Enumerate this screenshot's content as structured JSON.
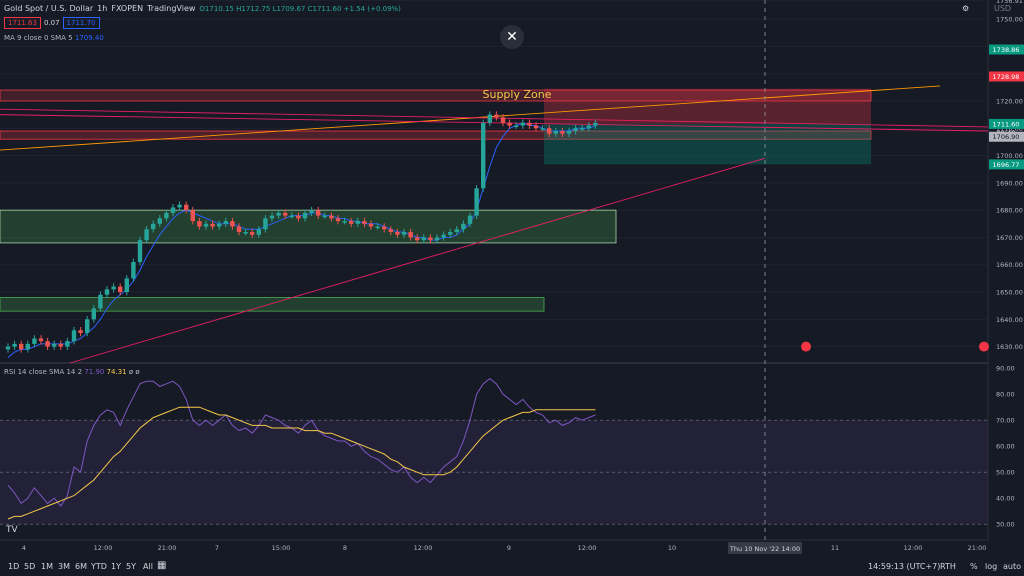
{
  "header": {
    "symbol": "Gold Spot / U.S. Dollar",
    "interval": "1h",
    "exchange": "FXOPEN",
    "provider": "TradingView",
    "ohlc": "O1710.15 H1712.75 L1709.67 C1711.60 +1.54 (+0.09%)",
    "bid": "1711.63",
    "spread": "0.07",
    "ask": "1711.70"
  },
  "indicators": {
    "ma_label": "MA 9 close 0 SMA 5",
    "ma_value": "1709.40",
    "rsi_label": "RSI 14 close SMA 14 2",
    "rsi_value": "71.90",
    "rsi_sma_value": "74.31",
    "rsi_extra": "ø ø"
  },
  "currency": "USD",
  "annotations": {
    "supply_zone": "Supply Zone",
    "logo": "TV"
  },
  "price_tags": {
    "t1738": "1738.86",
    "t1728": "1728.98",
    "t1711": "1711.60",
    "t_timer": "00:48",
    "t1706": "1706.90",
    "t1696": "1696.77"
  },
  "crosshair_label": "Thu 10 Nov '22  14:00",
  "bottom": {
    "ranges": [
      "1D",
      "5D",
      "1M",
      "3M",
      "6M",
      "YTD",
      "1Y",
      "5Y",
      "All"
    ],
    "time": "14:59:13 (UTC+7)",
    "session": "RTH",
    "pct": "%",
    "log": "log",
    "auto": "auto"
  },
  "colors": {
    "up": "#26a69a",
    "down": "#ef5350",
    "ma": "#2962ff",
    "rsi": "#7e57c2",
    "rsi_sma": "#f7c948",
    "bg": "#161a25"
  },
  "chart_data": {
    "type": "candlestick",
    "price_axis_ticks": [
      1756.91,
      1750.0,
      1740.0,
      1730.0,
      1720.0,
      1710.0,
      1700.0,
      1690.0,
      1680.0,
      1670.0,
      1660.0,
      1650.0,
      1640.0,
      1630.0
    ],
    "price_ylim": [
      1624,
      1757
    ],
    "rsi_axis_ticks": [
      90.0,
      80.0,
      70.0,
      60.0,
      50.0,
      40.0,
      30.0
    ],
    "rsi_ylim": [
      27,
      92
    ],
    "time_ticks": [
      "4",
      "12:00",
      "21:00",
      "7",
      "15:00",
      "8",
      "12:00",
      "9",
      "12:00",
      "10",
      "11",
      "12:00",
      "21:00"
    ],
    "closes": [
      1630,
      1631,
      1629,
      1631,
      1633,
      1632,
      1630,
      1631,
      1630,
      1632,
      1636,
      1635,
      1640,
      1644,
      1649,
      1651,
      1652,
      1650,
      1655,
      1661,
      1669,
      1673,
      1675,
      1677,
      1679,
      1681,
      1682,
      1680,
      1676,
      1674,
      1675,
      1674,
      1675,
      1676,
      1674,
      1672,
      1672,
      1671,
      1673,
      1677,
      1678,
      1679,
      1678,
      1678,
      1677,
      1679,
      1680,
      1678,
      1678,
      1677,
      1676,
      1676,
      1675,
      1676,
      1675,
      1674,
      1674,
      1673,
      1672,
      1671,
      1672,
      1670,
      1669,
      1670,
      1669,
      1670,
      1671,
      1672,
      1673,
      1675,
      1678,
      1688,
      1712,
      1715,
      1714,
      1712,
      1711,
      1711,
      1712,
      1711,
      1710,
      1710,
      1708,
      1709,
      1708,
      1709,
      1710,
      1710,
      1711,
      1712
    ],
    "ma": [
      1626,
      1628,
      1629,
      1629,
      1630,
      1631,
      1631,
      1631,
      1631,
      1631,
      1632,
      1633,
      1635,
      1637,
      1640,
      1644,
      1647,
      1649,
      1651,
      1654,
      1658,
      1663,
      1667,
      1671,
      1674,
      1677,
      1679,
      1680,
      1679,
      1678,
      1677,
      1676,
      1675,
      1675,
      1675,
      1674,
      1673,
      1673,
      1673,
      1674,
      1675,
      1676,
      1677,
      1678,
      1678,
      1678,
      1679,
      1679,
      1678,
      1678,
      1677,
      1677,
      1676,
      1676,
      1675,
      1675,
      1675,
      1674,
      1673,
      1672,
      1672,
      1671,
      1670,
      1670,
      1669,
      1669,
      1670,
      1670,
      1671,
      1673,
      1675,
      1680,
      1688,
      1696,
      1703,
      1707,
      1710,
      1711,
      1712,
      1711,
      1711,
      1710,
      1709,
      1709,
      1709,
      1709,
      1710,
      1710,
      1710,
      1711
    ],
    "rsi": [
      45,
      42,
      38,
      40,
      44,
      41,
      38,
      40,
      37,
      41,
      52,
      50,
      62,
      68,
      72,
      74,
      73,
      68,
      74,
      79,
      84,
      85,
      85,
      83,
      84,
      85,
      83,
      78,
      70,
      68,
      70,
      68,
      70,
      72,
      68,
      66,
      67,
      65,
      68,
      72,
      71,
      70,
      68,
      67,
      65,
      68,
      70,
      66,
      64,
      63,
      62,
      62,
      60,
      61,
      58,
      56,
      55,
      53,
      51,
      50,
      52,
      48,
      46,
      48,
      46,
      49,
      52,
      54,
      56,
      62,
      70,
      80,
      84,
      86,
      84,
      80,
      78,
      76,
      78,
      75,
      73,
      72,
      69,
      70,
      68,
      69,
      71,
      70,
      71,
      72
    ],
    "rsi_sma": [
      32,
      33,
      33,
      34,
      35,
      36,
      37,
      38,
      39,
      40,
      41,
      43,
      45,
      47,
      50,
      53,
      56,
      58,
      61,
      64,
      67,
      69,
      71,
      72,
      73,
      74,
      75,
      75,
      75,
      75,
      74,
      73,
      72,
      72,
      71,
      70,
      69,
      68,
      68,
      68,
      67,
      67,
      67,
      67,
      67,
      66,
      66,
      66,
      65,
      65,
      64,
      63,
      62,
      61,
      60,
      59,
      58,
      57,
      55,
      54,
      52,
      51,
      50,
      49,
      49,
      49,
      49,
      50,
      52,
      55,
      58,
      61,
      64,
      66,
      68,
      70,
      71,
      72,
      73,
      73,
      74,
      74,
      74,
      74,
      74,
      74,
      74,
      74,
      74,
      74
    ],
    "zones": [
      {
        "label": "Supply Zone",
        "low": 1720,
        "high": 1724
      },
      {
        "low": 1706,
        "high": 1709
      },
      {
        "low": 1668,
        "high": 1680
      },
      {
        "low": 1643,
        "high": 1648
      }
    ]
  }
}
